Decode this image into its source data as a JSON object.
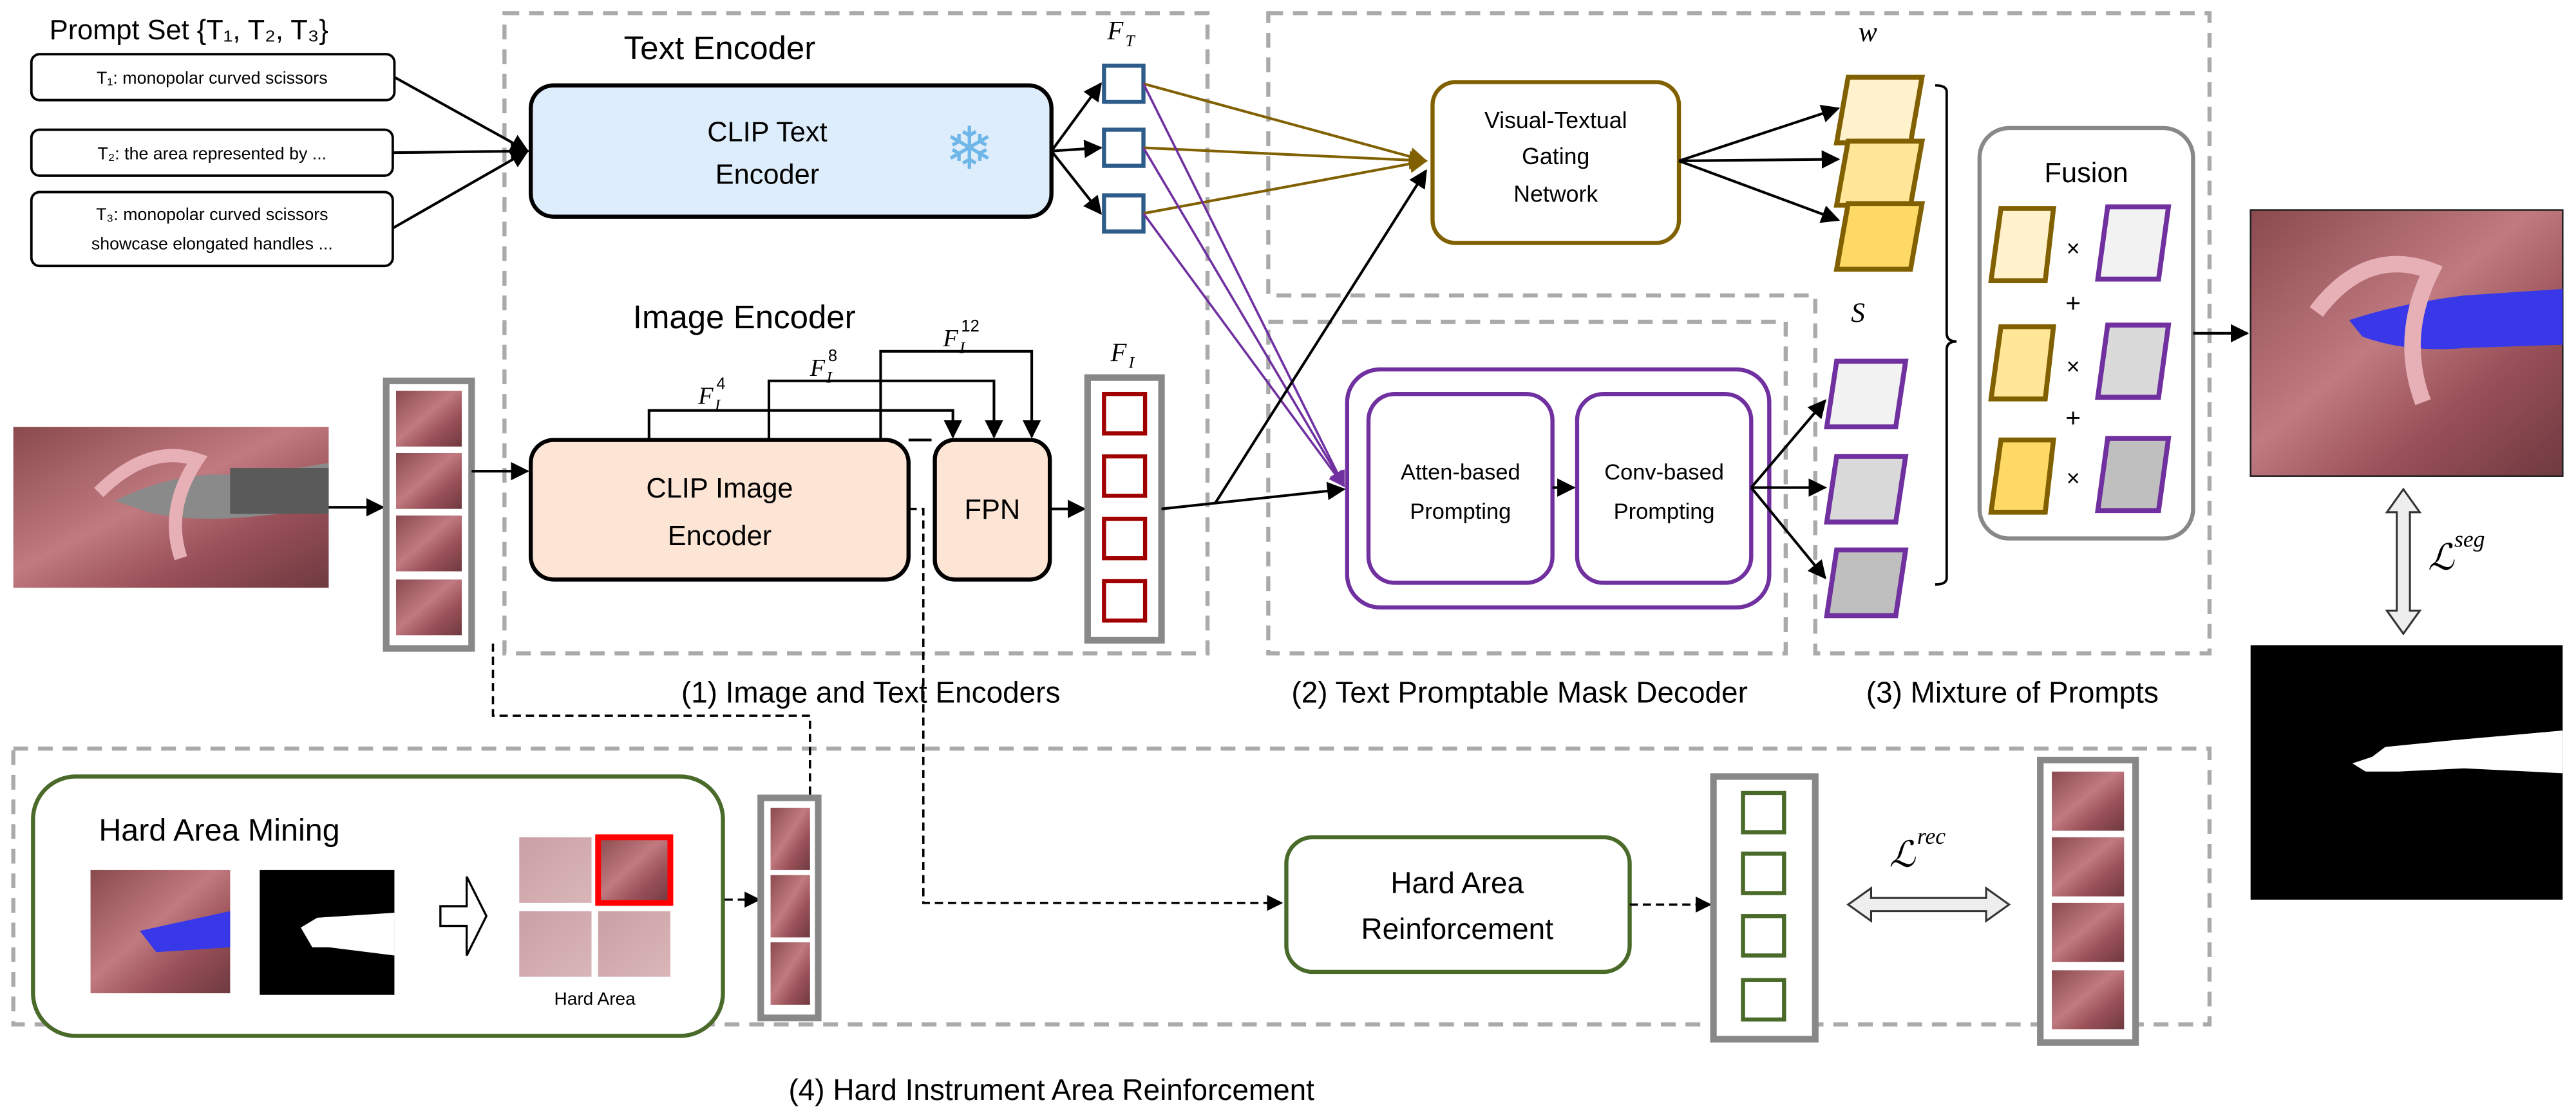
{
  "colors": {
    "text_encoder_fill": "#deedfb",
    "image_encoder_fill": "#fde5d6",
    "text_feature_stroke": "#2e5c8a",
    "image_feature_stroke": "#a00000",
    "gating_stroke": "#806000",
    "decoder_stroke": "#7030a0",
    "reinforcement_stroke": "#4a6a2a",
    "weight_fills": [
      "#fff2cc",
      "#ffe699",
      "#ffd966"
    ],
    "score_fills": [
      "#f2f2f2",
      "#d9d9d9",
      "#bfbfbf"
    ],
    "hard_area_highlight": "#ff0000",
    "instrument_highlight": "#3030e0"
  },
  "prompt_set": {
    "title": "Prompt Set {T₁, T₂, T₃}",
    "prompts": [
      {
        "line1": "T₁: monopolar curved scissors",
        "line2": ""
      },
      {
        "line1": "T₂: the area represented by ...",
        "line2": ""
      },
      {
        "line1": "T₃: monopolar curved scissors",
        "line2": "showcase elongated handles ..."
      }
    ]
  },
  "encoders": {
    "text_encoder_title": "Text Encoder",
    "clip_text_encoder": [
      "CLIP Text",
      "Encoder"
    ],
    "frozen_icon": "snowflake-icon",
    "image_encoder_title": "Image Encoder",
    "clip_image_encoder": [
      "CLIP Image",
      "Encoder"
    ],
    "fpn": "FPN",
    "text_features": {
      "base": "F",
      "sub": "T"
    },
    "image_features": {
      "base": "F",
      "sub": "I"
    },
    "skip_features": [
      {
        "base": "F",
        "sub": "I",
        "sup": "4"
      },
      {
        "base": "F",
        "sub": "I",
        "sup": "8"
      },
      {
        "base": "F",
        "sub": "I",
        "sup": "12"
      }
    ]
  },
  "decoder": {
    "gating_network": [
      "Visual-Textual",
      "Gating",
      "Network"
    ],
    "atten_prompting": [
      "Atten-based",
      "Prompting"
    ],
    "conv_prompting": [
      "Conv-based",
      "Prompting"
    ],
    "weights_label": "w",
    "scores_label": "S"
  },
  "fusion": {
    "title": "Fusion",
    "times": "×",
    "plus": "+"
  },
  "losses": {
    "seg": {
      "base": "ℒ",
      "sup": "seg"
    },
    "rec": {
      "base": "ℒ",
      "sup": "rec"
    }
  },
  "hard_area": {
    "mining_title": "Hard Area Mining",
    "hard_area_label": "Hard Area",
    "reinforcement": [
      "Hard Area",
      "Reinforcement"
    ]
  },
  "captions": {
    "section1": "(1) Image and Text Encoders",
    "section2": "(2) Text Promptable Mask Decoder",
    "section3": "(3) Mixture of Prompts",
    "section4": "(4) Hard Instrument Area Reinforcement"
  }
}
